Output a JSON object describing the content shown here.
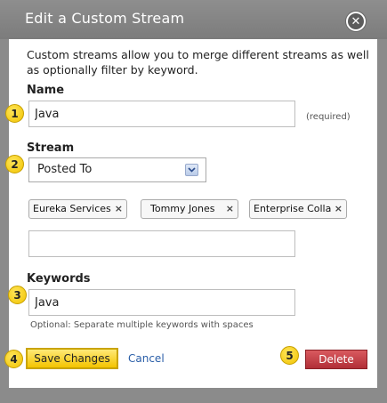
{
  "dialog": {
    "title": "Edit a Custom Stream",
    "close_icon": "close-icon"
  },
  "description": "Custom streams allow you to merge different streams as well as optionally filter by keyword.",
  "name_section": {
    "label": "Name",
    "value": "Java",
    "required_note": "(required)"
  },
  "stream_section": {
    "label": "Stream",
    "selected": "Posted To",
    "tags": [
      {
        "label": "Eureka Services"
      },
      {
        "label": "Tommy Jones"
      },
      {
        "label": "Enterprise Colla"
      }
    ],
    "tag_remove_glyph": "×",
    "add_input_value": ""
  },
  "keywords_section": {
    "label": "Keywords",
    "value": "Java",
    "hint": "Optional: Separate multiple keywords with spaces"
  },
  "actions": {
    "save_label": "Save Changes",
    "cancel_label": "Cancel",
    "delete_label": "Delete"
  },
  "callouts": [
    "1",
    "2",
    "3",
    "4",
    "5"
  ],
  "colors": {
    "titlebar": "#8e8e8e",
    "save_button": "#f4c400",
    "delete_button": "#b12f37",
    "link": "#2a5ea8",
    "callout": "#f1c300"
  }
}
